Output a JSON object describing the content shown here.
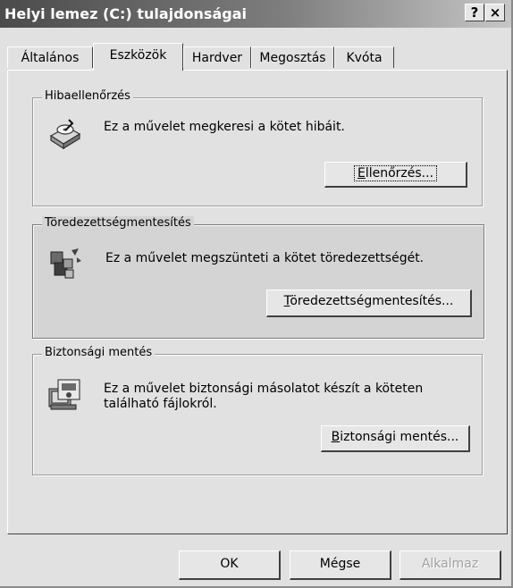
{
  "window": {
    "title": "Helyi lemez (C:) tulajdonságai",
    "help_label": "?",
    "close_label": "×"
  },
  "tabs": [
    {
      "label": "Általános",
      "active": false
    },
    {
      "label": "Eszközök",
      "active": true
    },
    {
      "label": "Hardver",
      "active": false
    },
    {
      "label": "Megosztás",
      "active": false
    },
    {
      "label": "Kvóta",
      "active": false
    }
  ],
  "groups": {
    "error_check": {
      "title": "Hibaellenőrzés",
      "description": "Ez a művelet megkeresi a kötet hibáit.",
      "button_accel": "E",
      "button_rest": "llenőrzés...",
      "icon": "disk-check-icon"
    },
    "defrag": {
      "title": "Töredezettségmentesítés",
      "description": "Ez a művelet megszünteti a kötet töredezettségét.",
      "button_accel": "T",
      "button_rest": "öredezettségmentesítés...",
      "icon": "defrag-icon"
    },
    "backup": {
      "title": "Biztonsági mentés",
      "description_line1": "Ez a művelet biztonsági másolatot készít a köteten",
      "description_line2": "található fájlokról.",
      "button_accel": "B",
      "button_rest": "iztonsági mentés...",
      "icon": "backup-icon"
    }
  },
  "footer": {
    "ok_label": "OK",
    "cancel_label": "Mégse",
    "apply_label": "Alkalmaz"
  }
}
